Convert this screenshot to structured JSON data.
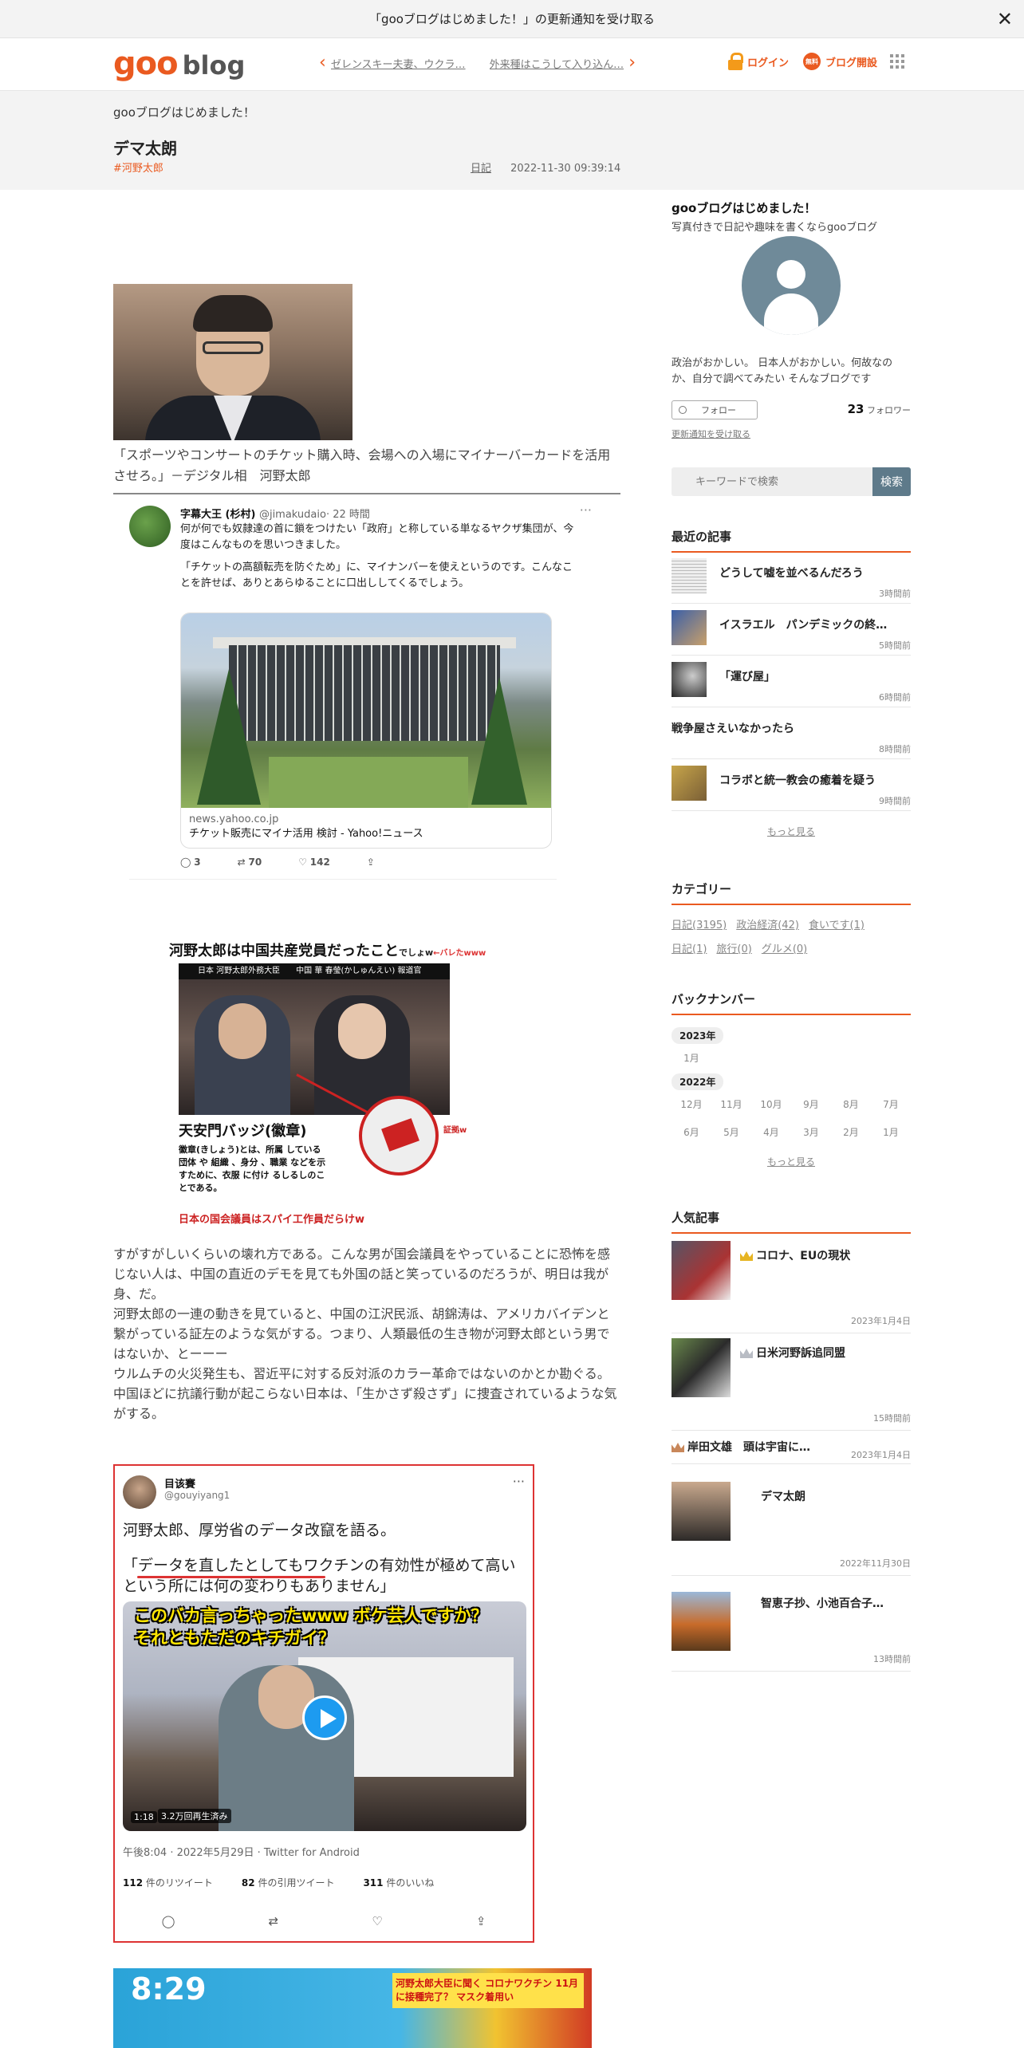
{
  "notice": {
    "text": "「gooブログはじめました！」の更新通知を受け取る",
    "close": "✕"
  },
  "header": {
    "logo_goo": "goo",
    "logo_blog": "blog",
    "prev_article": "ゼレンスキー夫妻、ウクラ…",
    "next_article": "外来種はこうして入り込ん…",
    "login": "ログイン",
    "start_blog": "ブログ開設",
    "start_badge": "無料"
  },
  "post": {
    "blog_name": "gooブログはじめました！",
    "title": "デマ太朗",
    "tag": "#河野太郎",
    "category": "日記",
    "datetime": "2022-11-30 09:39:14"
  },
  "content": {
    "caption1": "「スポーツやコンサートのチケット購入時、会場への入場にマイナーバーカードを活用させろ。」－デジタル相　河野太郎",
    "tweet1": {
      "author": "字幕大王 (杉村)",
      "handle": "@jimakudaio",
      "time": "· 22 時間",
      "more": "···",
      "p1": "何が何でも奴隷達の首に鎖をつけたい「政府」と称している単なるヤクザ集団が、今度はこんなものを思いつきました。",
      "p2": "「チケットの高額転売を防ぐため」に、マイナンバーを使えというのです。こんなことを許せば、ありとあらゆることに口出ししてくるでしょう。",
      "card_domain": "news.yahoo.co.jp",
      "card_title": "チケット販売にマイナ活用 検討 - Yahoo!ニュース",
      "replies": "3",
      "retweets": "70",
      "likes": "142"
    },
    "image2": {
      "headline": "河野太郎は中国共産党員だったこと",
      "headline_small": "でしょw",
      "headline_red": "←バレたwww",
      "band": "日本  河野太郎外務大臣　　中国  華 春瑩(かしゅんえい) 報道官",
      "subtitle": "天安門バッジ(徽章)",
      "desc": "徽章(きしょう)とは、所属 している 団体 や 組織 、身分 、職業 などを示すために、衣服 に付け るしるしのことである。",
      "proof": "証拠w",
      "footer": "日本の国会議員はスパイ工作員だらけw"
    },
    "article": [
      "すがすがしいくらいの壊れ方である。こんな男が国会議員をやっていることに恐怖を感じない人は、中国の直近のデモを見ても外国の話と笑っているのだろうが、明日は我が身、だ。",
      "河野太郎の一連の動きを見ていると、中国の江沢民派、胡錦涛は、アメリカバイデンと繋がっている証左のような気がする。つまり、人類最低の生き物が河野太郎という男ではないか、とーーー",
      "ウルムチの火災発生も、習近平に対する反対派のカラー革命ではないのかとか勘ぐる。",
      "中国ほどに抗議行動が起こらない日本は、「生かさず殺さず」に捜査されているような気がする。"
    ],
    "tweet2": {
      "name": "目该賽",
      "handle": "@gouyiyang1",
      "more": "···",
      "line1": "河野太郎、厚労省のデータ改竄を語る。",
      "line2": "「データを直したとしてもワクチンの有効性が極めて高いという所には何の変わりもありません」",
      "video_caption1": "このバカ言っちゃったwww ボケ芸人ですか？",
      "video_caption2": "それともただのキチガイ？",
      "duration": "1:18",
      "views": "3.2万回再生済み",
      "stamp": "午後8:04 · 2022年5月29日 · Twitter for Android",
      "retweets_n": "112",
      "retweets_l": "件のリツイート",
      "quotes_n": "82",
      "quotes_l": "件の引用ツイート",
      "likes_n": "311",
      "likes_l": "件のいいね"
    },
    "image3": {
      "clock": "8:29",
      "tag": "河野太郎大臣に聞く コロナワクチン 11月に接種完了？ マスク着用い"
    }
  },
  "sidebar": {
    "title": "gooブログはじめました！",
    "subtitle": "写真付きで日記や趣味を書くならgooブログ",
    "bio": "政治がおかしい。 日本人がおかしい。何故なのか、自分で調べてみたい そんなブログです",
    "follow": "フォロー",
    "follower_count": "23",
    "follower_label": "フォロワー",
    "notify": "更新通知を受け取る",
    "search_placeholder": "キーワードで検索",
    "search_button": "検索",
    "recent_heading": "最近の記事",
    "recent": [
      {
        "title": "どうして嘘を並べるんだろう",
        "ago": "3時間前"
      },
      {
        "title": "イスラエル　パンデミックの終…",
        "ago": "5時間前"
      },
      {
        "title": "「運び屋」",
        "ago": "6時間前"
      },
      {
        "title": "戦争屋さえいなかったら",
        "ago": "8時間前"
      },
      {
        "title": "コラボと統一教会の癒着を疑う",
        "ago": "9時間前"
      }
    ],
    "more1": "もっと見る",
    "category_heading": "カテゴリー",
    "categories": [
      "日記(3195)",
      "政治経済(42)",
      "食いです(1)",
      "日記(1)",
      "旅行(0)",
      "グルメ(0)"
    ],
    "backnumber_heading": "バックナンバー",
    "year1": "2023年",
    "months2023": [
      "1月"
    ],
    "year2": "2022年",
    "months2022": [
      "12月",
      "11月",
      "10月",
      "9月",
      "8月",
      "7月",
      "6月",
      "5月",
      "4月",
      "3月",
      "2月",
      "1月"
    ],
    "more2": "もっと見る",
    "popular_heading": "人気記事",
    "popular": [
      {
        "title": "コロナ、EUの現状",
        "date": "2023年1月4日"
      },
      {
        "title": "日米河野訴追同盟",
        "date": "15時間前"
      },
      {
        "title": "岸田文雄　頭は宇宙に…",
        "date": "2023年1月4日"
      },
      {
        "title": "デマ太朗",
        "date": "2022年11月30日"
      },
      {
        "title": "智恵子抄、小池百合子…",
        "date": "13時間前"
      }
    ]
  }
}
